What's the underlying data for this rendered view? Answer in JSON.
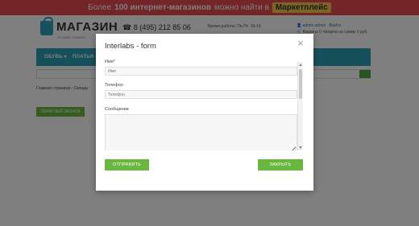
{
  "promo": {
    "text_before": "Более",
    "text_bold": "100 интернет-магазинов",
    "text_after": "можно найти в",
    "marketplace": "Маркетплейс"
  },
  "header": {
    "logo_title": "МАГАЗИН",
    "logo_subtitle": "ЛУЧШИЕ ТОВАРЫ",
    "phone": "8 (495) 212 85 06",
    "work_time": "Время работы: Пн-Пт: 10-19",
    "user_link": "admin admin",
    "logout_link": "Выйти",
    "cart_link": "Корзина",
    "cart_summary": "0 товаров на сумму 0 руб."
  },
  "nav": {
    "items": [
      "ОБУВЬ",
      "ПЛАТЬЯ"
    ]
  },
  "breadcrumb": {
    "home": "Главная страница",
    "separator": "›",
    "current": "Склады"
  },
  "callback_button": "ОБРАТНЫЙ ЗВОНОК",
  "modal": {
    "title": "Interlabs - form",
    "close_glyph": "×",
    "name_label": "Имя*",
    "name_placeholder": "Имя",
    "phone_label": "Телефон",
    "phone_placeholder": "Телефон",
    "message_label": "Сообщение",
    "send_button": "ОТПРАВИТЬ",
    "close_button": "ЗАКРЫТЬ"
  },
  "colors": {
    "promo_red": "#e84a4f",
    "brand_teal": "#2aa0b6",
    "button_green": "#6ab63f"
  }
}
